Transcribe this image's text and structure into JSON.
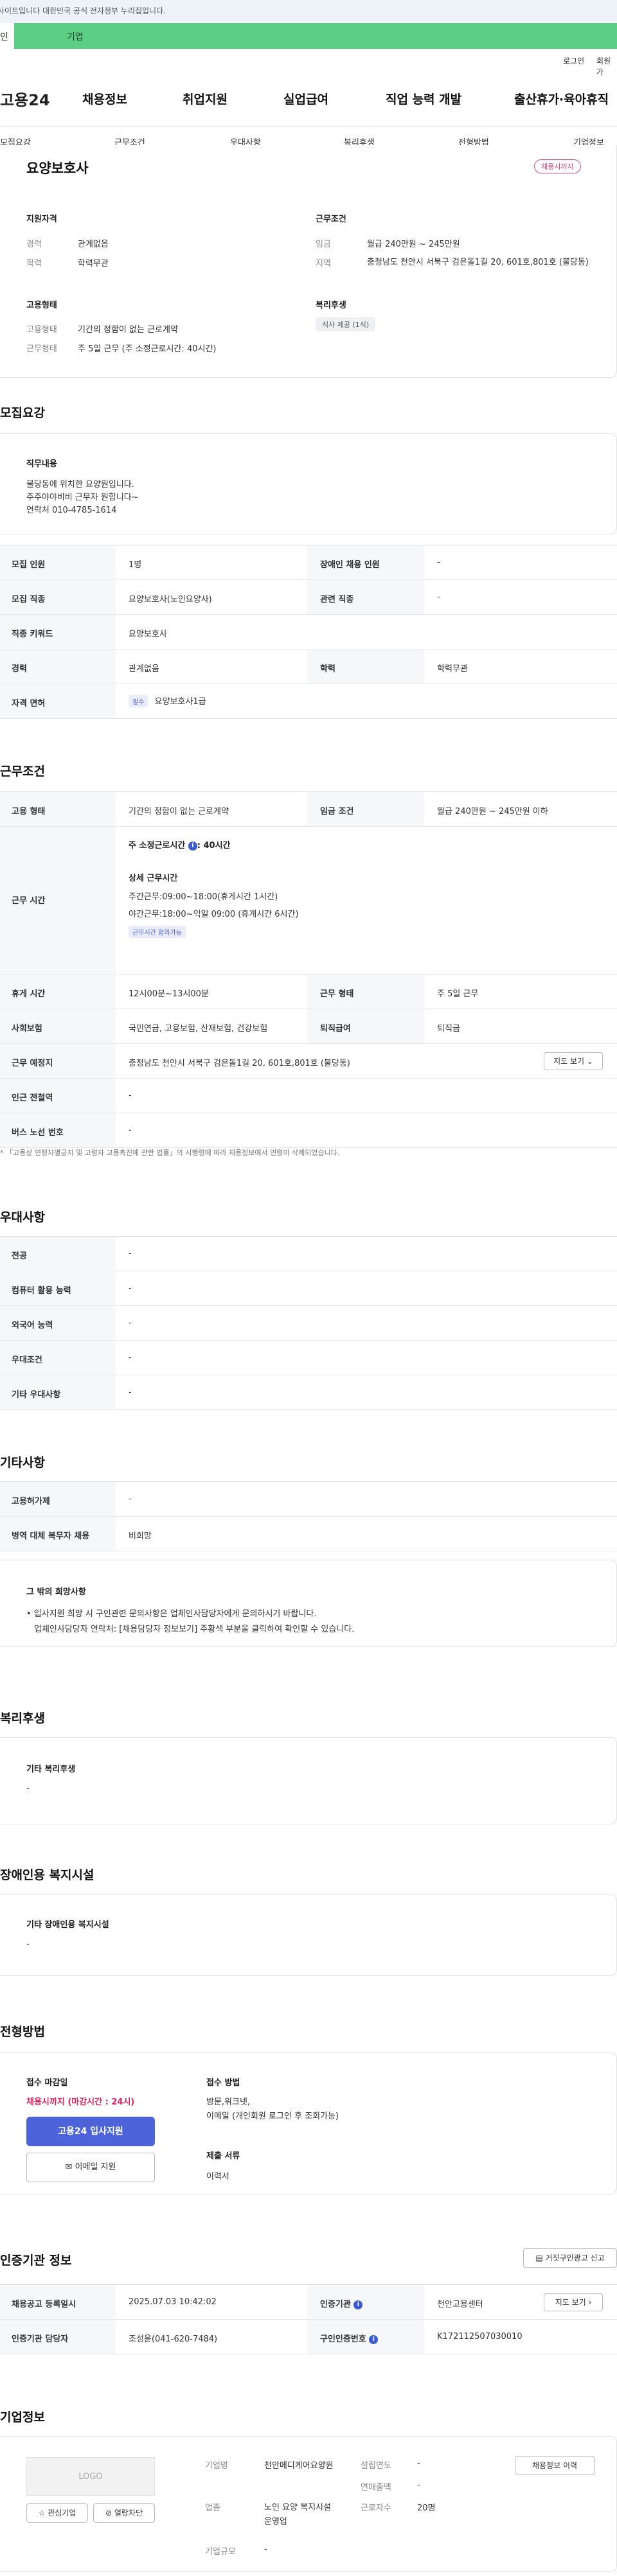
{
  "banner": {
    "text": "사이트입니다 대한민국 공식 전자정부 누리집입니다."
  },
  "gov_tabs": {
    "left": "인",
    "right": "기업"
  },
  "util": {
    "login": "로그인",
    "join": "회원가"
  },
  "header": {
    "logo": "고용24",
    "nav": [
      "채용정보",
      "취업지원",
      "실업급여",
      "직업 능력 개발",
      "출산휴가·육아휴직"
    ]
  },
  "subnav": [
    "모집요강",
    "근무조건",
    "우대사항",
    "복리후생",
    "전형방법",
    "기업정보"
  ],
  "summary": {
    "title": "요양보호사",
    "deadline_badge": "채용시까지",
    "qual_title": "지원자격",
    "career_label": "경력",
    "career_value": "관계없음",
    "edu_label": "학력",
    "edu_value": "학력무관",
    "cond_title": "근무조건",
    "wage_label": "임금",
    "wage_value": "월급 240만원 ~ 245만원",
    "region_label": "지역",
    "region_value": "충청남도 천안시 서북구 검은돌1길 20, 601호,801호 (불당동)",
    "emp_title": "고용형태",
    "emptype_label": "고용형태",
    "emptype_value": "기간의 정함이 없는 근로계약",
    "worktype_label": "근무형태",
    "worktype_value": "주 5일 근무 (주 소정근로시간: 40시간)",
    "welfare_title": "복리후생",
    "welfare_tag": "식사 제공 (1식)"
  },
  "recruit": {
    "heading": "모집요강",
    "duty_title": "직무내용",
    "duty_lines": [
      "불당동에 위치한 요양원입니다.",
      "주주야야비비 근무자 원합니다~",
      "연락처 010-4785-1614"
    ],
    "rows": [
      {
        "k1": "모집 인원",
        "v1": "1명",
        "k2": "장애인 채용 인원",
        "v2": "-"
      },
      {
        "k1": "모집 직종",
        "v1": "요양보호사(노인요양사)",
        "k2": "관련 직종",
        "v2": "-"
      },
      {
        "k1": "직종 키워드",
        "v1": "요양보호사"
      },
      {
        "k1": "경력",
        "v1": "관계없음",
        "k2": "학력",
        "v2": "학력무관"
      },
      {
        "k1": "자격 면허",
        "tag": "필수",
        "v1": "요양보호사1급"
      }
    ]
  },
  "workcond": {
    "heading": "근무조건",
    "emp_k": "고용 형태",
    "emp_v": "기간의 정함이 없는 근로계약",
    "wage_k": "임금 조건",
    "wage_v": "월급 240만원 ~ 245만원 이하",
    "time_k": "근무 시간",
    "weekly": "주 소정근로시간",
    "weekly_val": ": 40시간",
    "detail_title": "상세 근무시간",
    "detail_lines": [
      "주간근무:09:00~18:00(휴게시간 1시간)",
      "야간근무:18:00~익일 09:00 (휴게시간 6시간)"
    ],
    "flex_tag": "근무시간 협의가능",
    "rest_k": "휴게 시간",
    "rest_v": "12시00분~13시00분",
    "form_k": "근무 형태",
    "form_v": "주 5일 근무",
    "ins_k": "사회보험",
    "ins_v": "국민연금, 고용보험, 산재보험, 건강보험",
    "ret_k": "퇴직급여",
    "ret_v": "퇴직금",
    "place_k": "근무 예정지",
    "place_v": "충청남도 천안시 서북구 검은돌1길 20, 601호,801호 (불당동)",
    "map_btn": "지도 보기",
    "subway_k": "인근 전철역",
    "subway_v": "-",
    "bus_k": "버스 노선 번호",
    "bus_v": "-",
    "note": "* 「고용상 연령차별금지 및 고령자 고용촉진에 관한 법률」의 시행령에 따라 채용정보에서 연령이 삭제되었습니다."
  },
  "prefer": {
    "heading": "우대사항",
    "rows": [
      {
        "k": "전공",
        "v": "-"
      },
      {
        "k": "컴퓨터 활용 능력",
        "v": "-"
      },
      {
        "k": "외국어 능력",
        "v": "-"
      },
      {
        "k": "우대조건",
        "v": "-"
      },
      {
        "k": "기타 우대사항",
        "v": "-"
      }
    ]
  },
  "etc": {
    "heading": "기타사항",
    "rows": [
      {
        "k": "고용허가제",
        "v": "-"
      },
      {
        "k": "병역 대체 복무자 채용",
        "v": "비희망"
      }
    ],
    "hope_title": "그 밖의 희망사항",
    "hope_lines": [
      "• 입사지원 희망 시 구인관련 문의사항은 업체인사담당자에게 문의하시기 바랍니다.",
      "업체인사담당자 연락처: [채용담당자 정보보기] 주황색 부분을 클릭하여 확인할 수 있습니다."
    ]
  },
  "welfare": {
    "heading": "복리후생",
    "box_title": "기타 복리후생",
    "box_val": "-"
  },
  "disabled": {
    "heading": "장애인용 복지시설",
    "box_title": "기타 장애인용 복지시설",
    "box_val": "-"
  },
  "process": {
    "heading": "전형방법",
    "deadline_title": "접수 마감일",
    "deadline_val": "채용시까지 (마감시간 : 24시)",
    "apply_btn": "고용24 입사지원",
    "email_btn": "이메일 지원",
    "method_title": "접수 방법",
    "method_lines": [
      "방문,워크넷,",
      "이메일 (개인회원 로그인 후 조회가능)"
    ],
    "docs_title": "제출 서류",
    "docs_val": "이력서"
  },
  "cert": {
    "heading": "인증기관 정보",
    "report_btn": "거짓구인광고 신고",
    "reg_k": "채용공고 등록일시",
    "reg_v": "2025.07.03 10:42:02",
    "org_k": "인증기관",
    "org_v": "천안고용센터",
    "mgr_k": "인증기관 담당자",
    "mgr_v": "조성윤(041-620-7484)",
    "num_k": "구인인증번호",
    "num_v": "K172112507030010",
    "map_btn": "지도 보기"
  },
  "company": {
    "heading": "기업정보",
    "logo": "LOGO",
    "fav_btn": "관심기업",
    "block_btn": "열람차단",
    "name_k": "기업명",
    "name_v": "천안메디케어요양원",
    "ind_k": "업종",
    "ind_v": "노인 요양 복지시설 운영업",
    "scale_k": "기업규모",
    "scale_v": "-",
    "est_k": "설립연도",
    "est_v": "-",
    "sales_k": "연매출액",
    "sales_v": "-",
    "emp_k": "근로자수",
    "emp_v": "20명",
    "more_btn": "채용정보 이력"
  }
}
